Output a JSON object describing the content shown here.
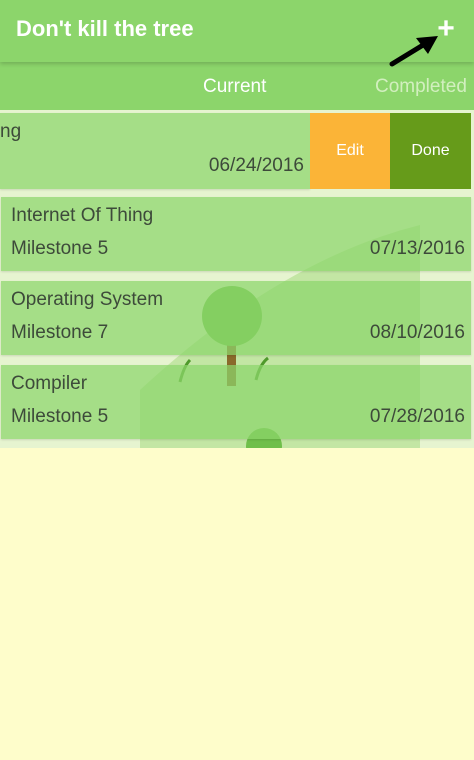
{
  "app": {
    "title": "Don't kill the tree",
    "add_label": "+"
  },
  "tabs": [
    {
      "label": "Current",
      "selected": true
    },
    {
      "label": "Completed",
      "selected": false
    }
  ],
  "tasks": [
    {
      "title": "ng",
      "subtitle": "",
      "date": "06/24/2016",
      "swiped": true
    },
    {
      "title": "Internet Of Thing",
      "subtitle": "Milestone 5",
      "date": "07/13/2016"
    },
    {
      "title": "Operating System",
      "subtitle": "Milestone 7",
      "date": "08/10/2016"
    },
    {
      "title": "Compiler",
      "subtitle": "Milestone 5",
      "date": "07/28/2016"
    }
  ],
  "swipe_actions": {
    "edit_label": "Edit",
    "done_label": "Done"
  },
  "colors": {
    "primary": "#8cd56b",
    "edit": "#fbb437",
    "done": "#669b1a",
    "background": "#fefdcb"
  },
  "icons": {
    "add": "plus-icon",
    "annotation": "arrow-icon",
    "illustration": "tree-illustration"
  }
}
